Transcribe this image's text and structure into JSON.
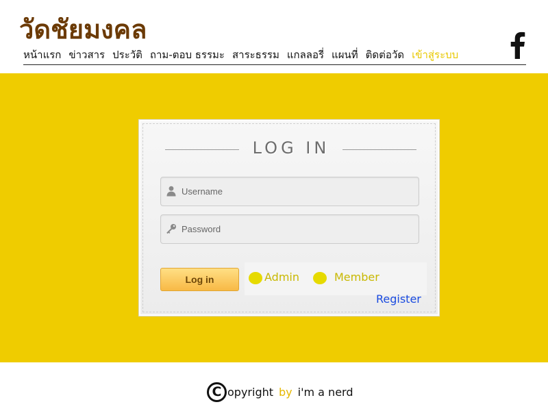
{
  "header": {
    "site_title": "วัดชัยมงคล",
    "nav_items": [
      {
        "label": "หน้าแรก"
      },
      {
        "label": "ข่าวสาร"
      },
      {
        "label": "ประวัติ"
      },
      {
        "label": "ถาม-ตอบ ธรรมะ"
      },
      {
        "label": "สาระธรรม"
      },
      {
        "label": "แกลลอรี่"
      },
      {
        "label": "แผนที่"
      },
      {
        "label": "ติดต่อวัด"
      },
      {
        "label": "เข้าสู่ระบบ",
        "active": true
      }
    ],
    "social_icon": "facebook-icon"
  },
  "login": {
    "title": "LOG IN",
    "username_placeholder": "Username",
    "password_placeholder": "Password",
    "username_icon": "user-icon",
    "password_icon": "key-icon",
    "submit_label": "Log in",
    "roles": [
      {
        "label": "Admin"
      },
      {
        "label": "Member"
      }
    ],
    "register_label": "Register"
  },
  "footer": {
    "copyright_symbol": "C",
    "copyright_text": "opyright",
    "by_text": "by",
    "author_text": "i'm a nerd"
  },
  "colors": {
    "brand_title": "#6b3a05",
    "band_background": "#efcc00",
    "active_nav": "#e8c800",
    "radio_fill": "#e6da00",
    "register_link": "#1a4be0",
    "login_button": "#f8b945"
  }
}
